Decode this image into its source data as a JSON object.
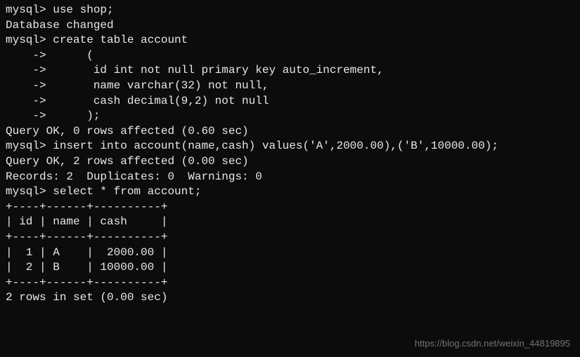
{
  "lines": {
    "l0": "mysql> use shop;",
    "l1": "Database changed",
    "l2": "mysql> create table account",
    "l3": "    ->      (",
    "l4": "    ->       id int not null primary key auto_increment,",
    "l5": "    ->       name varchar(32) not null,",
    "l6": "    ->       cash decimal(9,2) not null",
    "l7": "    ->      );",
    "l8": "Query OK, 0 rows affected (0.60 sec)",
    "l9": "",
    "l10": "mysql> insert into account(name,cash) values('A',2000.00),('B',10000.00);",
    "l11": "Query OK, 2 rows affected (0.00 sec)",
    "l12": "Records: 2  Duplicates: 0  Warnings: 0",
    "l13": "",
    "l14": "mysql> select * from account;",
    "l15": "+----+------+----------+",
    "l16": "| id | name | cash     |",
    "l17": "+----+------+----------+",
    "l18": "|  1 | A    |  2000.00 |",
    "l19": "|  2 | B    | 10000.00 |",
    "l20": "+----+------+----------+",
    "l21": "2 rows in set (0.00 sec)"
  },
  "chart_data": {
    "type": "table",
    "title": "account",
    "columns": [
      "id",
      "name",
      "cash"
    ],
    "rows": [
      {
        "id": 1,
        "name": "A",
        "cash": 2000.0
      },
      {
        "id": 2,
        "name": "B",
        "cash": 10000.0
      }
    ]
  },
  "watermark": "https://blog.csdn.net/weixin_44819895"
}
